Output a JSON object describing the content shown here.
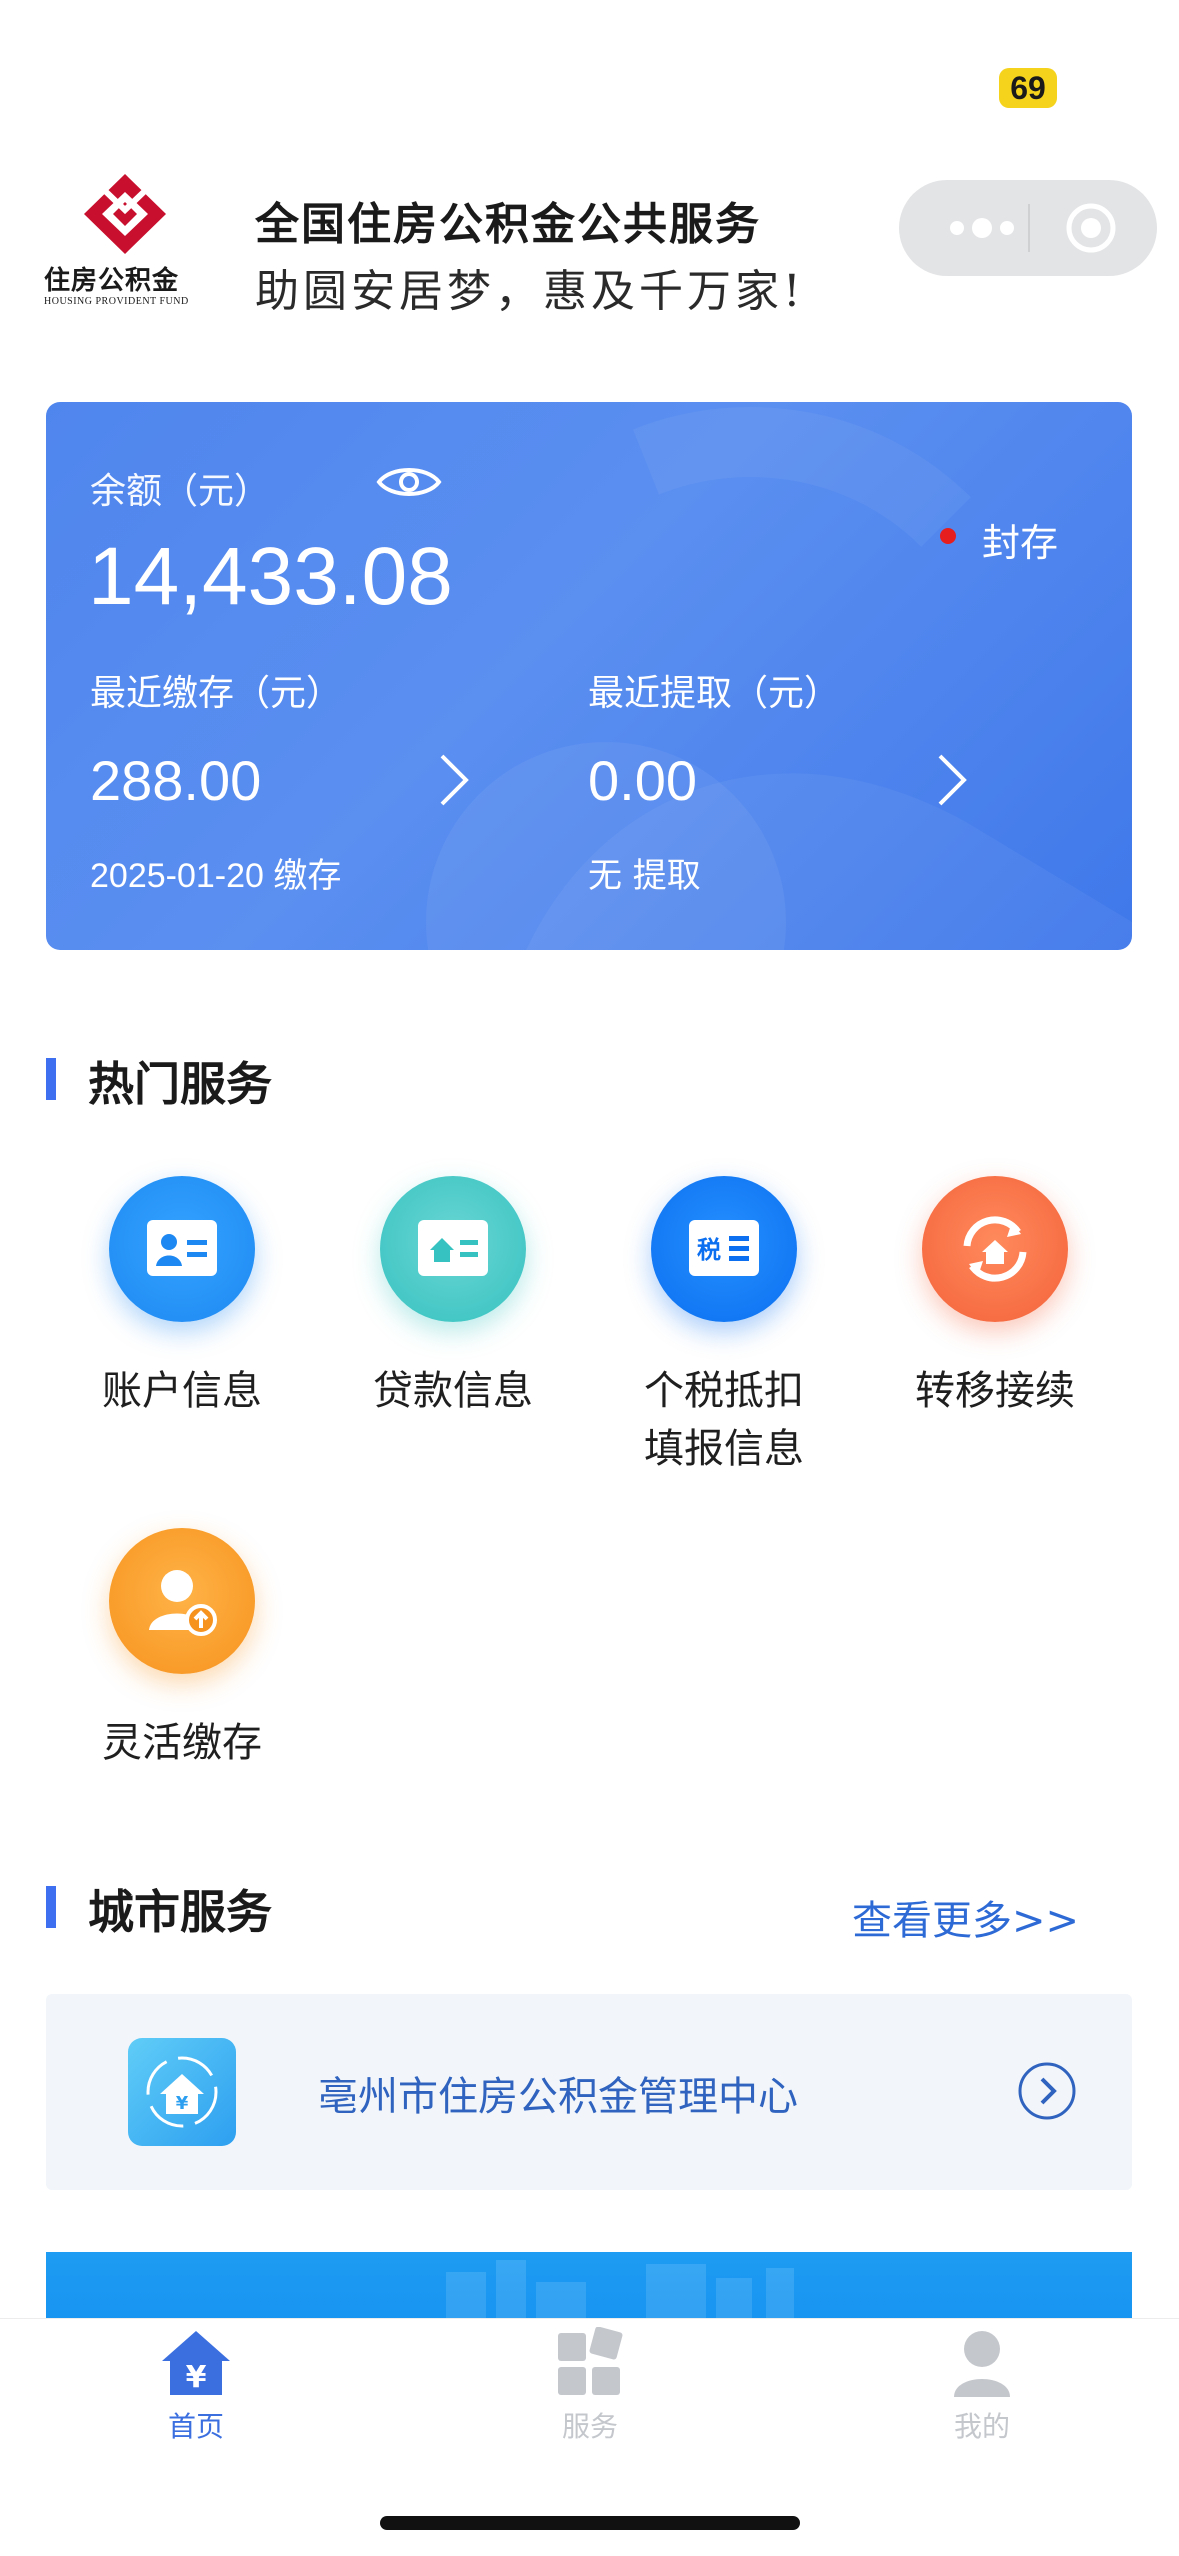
{
  "status_bar": {
    "badge": "69"
  },
  "header": {
    "logo_cn": "住房公积金",
    "logo_en": "HOUSING PROVIDENT FUND",
    "title": "全国住房公积金公共服务",
    "slogan": "助圆安居梦，惠及千万家!"
  },
  "balance_card": {
    "balance_label": "余额（元）",
    "balance_value": "14,433.08",
    "status": "封存",
    "status_color": "#e61e1e",
    "deposit_label": "最近缴存（元）",
    "deposit_value": "288.00",
    "deposit_note": "2025-01-20 缴存",
    "withdraw_label": "最近提取（元）",
    "withdraw_value": "0.00",
    "withdraw_note": "无 提取"
  },
  "hot_services": {
    "title": "热门服务",
    "items": [
      {
        "label": "账户信息",
        "icon": "account-card-icon"
      },
      {
        "label": "贷款信息",
        "icon": "loan-house-icon"
      },
      {
        "label": "个税抵扣填报信息",
        "line1": "个税抵扣",
        "line2": "填报信息",
        "icon": "tax-icon"
      },
      {
        "label": "转移接续",
        "icon": "transfer-icon"
      },
      {
        "label": "灵活缴存",
        "icon": "flexible-deposit-icon"
      }
    ]
  },
  "city_services": {
    "title": "城市服务",
    "more": "查看更多>>",
    "center_name": "亳州市住房公积金管理中心"
  },
  "tabbar": {
    "items": [
      {
        "label": "首页",
        "icon": "home-yuan-icon",
        "active": true
      },
      {
        "label": "服务",
        "icon": "services-grid-icon",
        "active": false
      },
      {
        "label": "我的",
        "icon": "profile-icon",
        "active": false
      }
    ],
    "active_color": "#3b6fe0",
    "inactive_color": "#c4c7cc"
  }
}
